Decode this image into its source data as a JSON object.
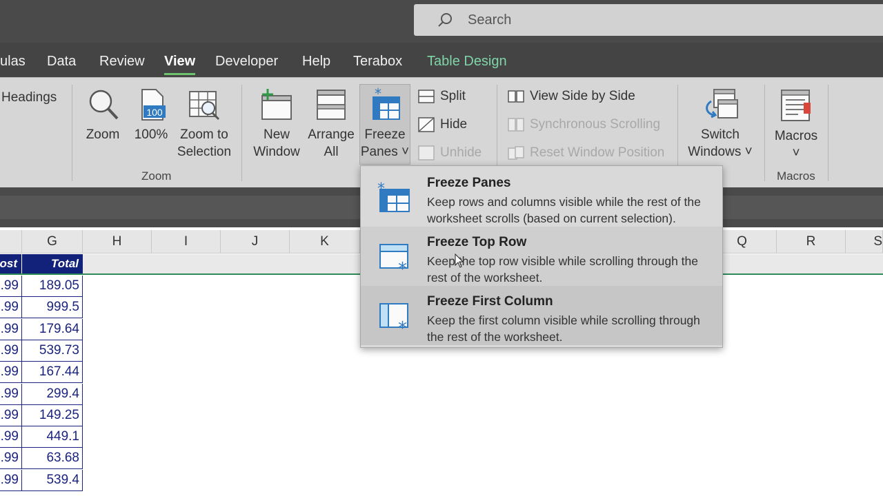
{
  "search": {
    "placeholder": "Search"
  },
  "tabs": [
    {
      "label": "ulas",
      "active": false
    },
    {
      "label": "Data",
      "active": false
    },
    {
      "label": "Review",
      "active": false
    },
    {
      "label": "View",
      "active": true
    },
    {
      "label": "Developer",
      "active": false
    },
    {
      "label": "Help",
      "active": false
    },
    {
      "label": "Terabox",
      "active": false
    },
    {
      "label": "Table Design",
      "active": false
    }
  ],
  "ribbon": {
    "headings_label": "Headings",
    "zoom": {
      "line1": "Zoom",
      "line2": ""
    },
    "hundred": {
      "line1": "100%",
      "badge": "100"
    },
    "zoom_selection": {
      "line1": "Zoom to",
      "line2": "Selection"
    },
    "zoom_group_label": "Zoom",
    "new_window": {
      "line1": "New",
      "line2": "Window"
    },
    "arrange_all": {
      "line1": "Arrange",
      "line2": "All"
    },
    "freeze_panes": {
      "line1": "Freeze",
      "line2": "Panes ˅"
    },
    "split": "Split",
    "hide": "Hide",
    "unhide": "Unhide",
    "view_side_by_side": "View Side by Side",
    "sync_scrolling": "Synchronous Scrolling",
    "reset_window": "Reset Window Position",
    "switch_windows": {
      "line1": "Switch",
      "line2": "Windows ˅"
    },
    "macros": {
      "line1": "Macros",
      "line2": "˅"
    },
    "macros_group_label": "Macros"
  },
  "columns": [
    "G",
    "H",
    "I",
    "J",
    "K",
    "Q",
    "R",
    "S"
  ],
  "table": {
    "headers": [
      "ost",
      "Total"
    ],
    "rows": [
      [
        ".99",
        "189.05"
      ],
      [
        ".99",
        "999.5"
      ],
      [
        ".99",
        "179.64"
      ],
      [
        ".99",
        "539.73"
      ],
      [
        ".99",
        "167.44"
      ],
      [
        ".99",
        "299.4"
      ],
      [
        ".99",
        "149.25"
      ],
      [
        ".99",
        "449.1"
      ],
      [
        ".99",
        "63.68"
      ],
      [
        ".99",
        "539.4"
      ]
    ]
  },
  "dropdown": {
    "items": [
      {
        "title": "Freeze Panes",
        "desc": "Keep rows and columns visible while the rest of the worksheet scrolls (based on current selection)."
      },
      {
        "title": "Freeze Top Row",
        "desc": "Keep the top row visible while scrolling through the rest of the worksheet."
      },
      {
        "title": "Freeze First Column",
        "desc": "Keep the first column visible while scrolling through the rest of the worksheet."
      }
    ]
  },
  "colors": {
    "accent": "#2e8b57",
    "header_fill": "#12217a",
    "data_text": "#1a237e",
    "icon_blue": "#2f7ac0"
  }
}
